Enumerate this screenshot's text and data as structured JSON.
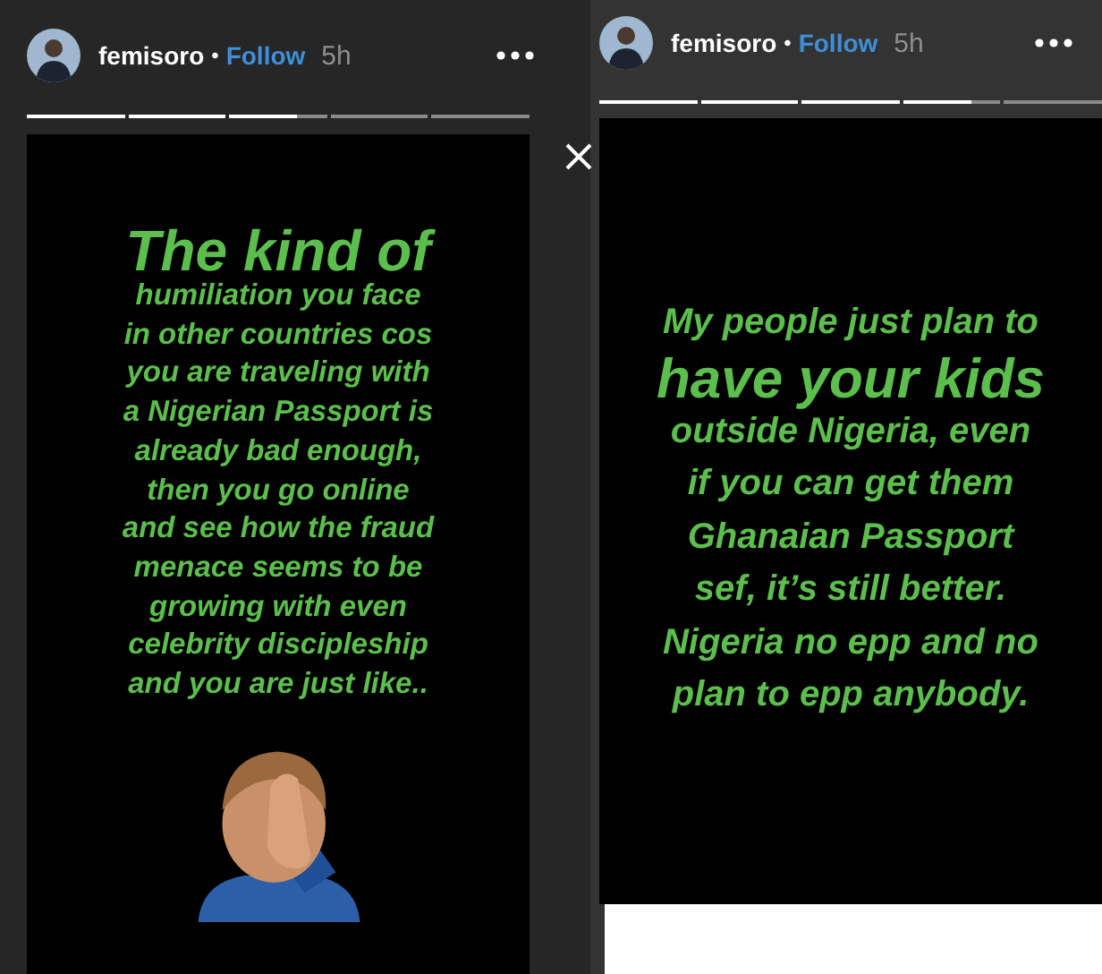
{
  "stories": [
    {
      "username": "femisoro",
      "separator": "•",
      "follow": "Follow",
      "time": "5h",
      "progress": [
        {
          "level": 1
        },
        {
          "level": 1
        },
        {
          "level": 0.7
        },
        {
          "level": 0
        },
        {
          "level": 0
        }
      ],
      "lines": [
        {
          "kind": "headline",
          "text": "The kind of"
        },
        {
          "kind": "line",
          "text": "humiliation you face"
        },
        {
          "kind": "line",
          "text": "in other countries cos"
        },
        {
          "kind": "line",
          "text": "you are traveling with"
        },
        {
          "kind": "line",
          "text": "a Nigerian Passport is"
        },
        {
          "kind": "line",
          "text": "already bad enough,"
        },
        {
          "kind": "line",
          "text": "then you go online"
        },
        {
          "kind": "line",
          "text": "and see how the fraud"
        },
        {
          "kind": "line",
          "text": "menace seems to be"
        },
        {
          "kind": "line",
          "text": "growing with even"
        },
        {
          "kind": "line",
          "text": "celebrity discipleship"
        },
        {
          "kind": "line",
          "text": "and you are just like.."
        }
      ],
      "sticker": {
        "kind": "facepalm"
      }
    },
    {
      "username": "femisoro",
      "separator": "•",
      "follow": "Follow",
      "time": "5h",
      "progress": [
        {
          "level": 1
        },
        {
          "level": 1
        },
        {
          "level": 1
        },
        {
          "level": 0.7
        },
        {
          "level": 0
        }
      ],
      "lines": [
        {
          "kind": "line",
          "text": "My people just plan to"
        },
        {
          "kind": "headline",
          "text": "have your kids"
        },
        {
          "kind": "line",
          "text": "outside Nigeria, even"
        },
        {
          "kind": "line",
          "text": "if you can get them"
        },
        {
          "kind": "line",
          "text": "Ghanaian Passport"
        },
        {
          "kind": "line",
          "text": "sef, it’s still better."
        },
        {
          "kind": "line",
          "text": "Nigeria no epp and no"
        },
        {
          "kind": "line",
          "text": "plan to epp anybody."
        }
      ]
    }
  ]
}
